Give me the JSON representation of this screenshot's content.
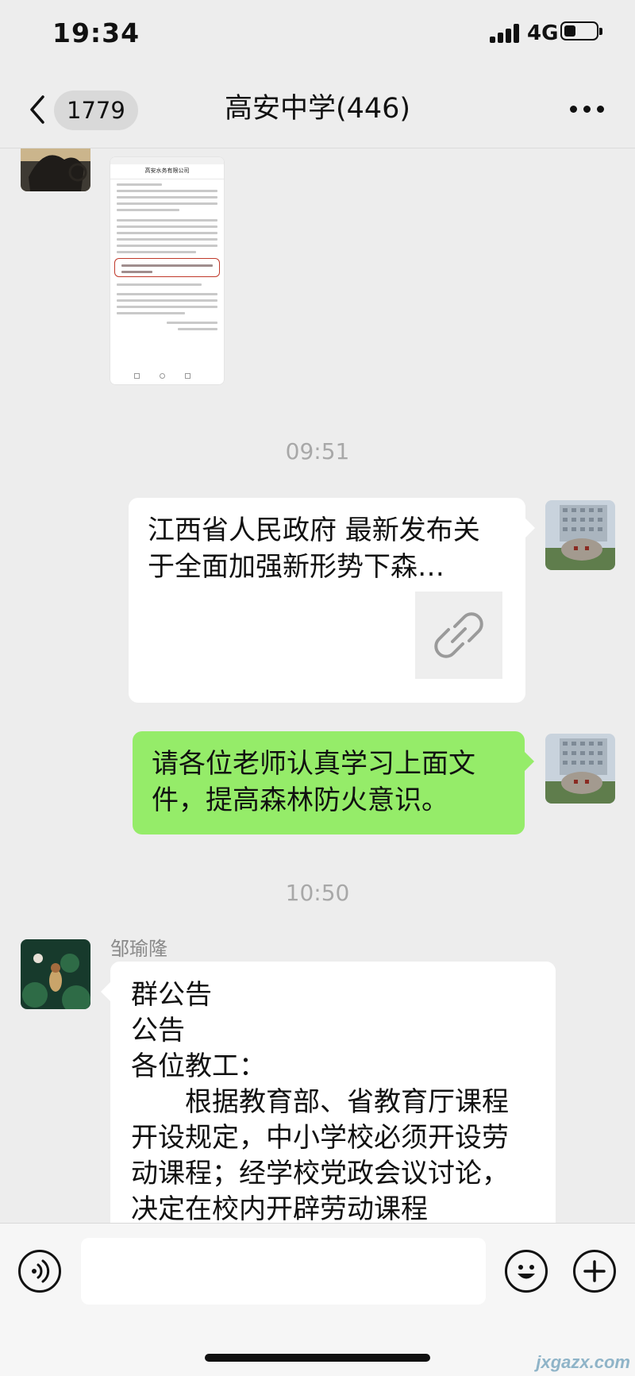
{
  "status_bar": {
    "time": "19:34",
    "network": "4G",
    "battery_level": 0.4
  },
  "nav": {
    "back_icon": "chevron-left-icon",
    "unread_count": "1779",
    "title": "高安中学(446)",
    "more_icon": "ellipsis-icon"
  },
  "messages": {
    "image_message": {
      "doc_header": "高安水务有限公司"
    },
    "time_1": "09:51",
    "link_card": {
      "title": "江西省人民政府 最新发布关于全面加强新形势下森…",
      "thumb_icon": "link-icon"
    },
    "text_message": "请各位老师认真学习上面文件，提高森林防火意识。",
    "time_2": "10:50",
    "notice": {
      "sender": "邹瑜隆",
      "text": "群公告\n公告\n各位教工：\n　　根据教育部、省教育厅课程开设规定，中小学校必须开设劳动课程；经学校党政会议讨论，决定在校内开辟劳动课程"
    }
  },
  "input_bar": {
    "voice_icon": "voice-icon",
    "input_value": "",
    "emoji_icon": "emoji-icon",
    "plus_icon": "plus-icon"
  },
  "watermark": "jxgazx.com",
  "colors": {
    "background": "#ededed",
    "sent_bubble": "#95ec69",
    "received_bubble": "#ffffff",
    "time_label": "#a8a8a8"
  }
}
